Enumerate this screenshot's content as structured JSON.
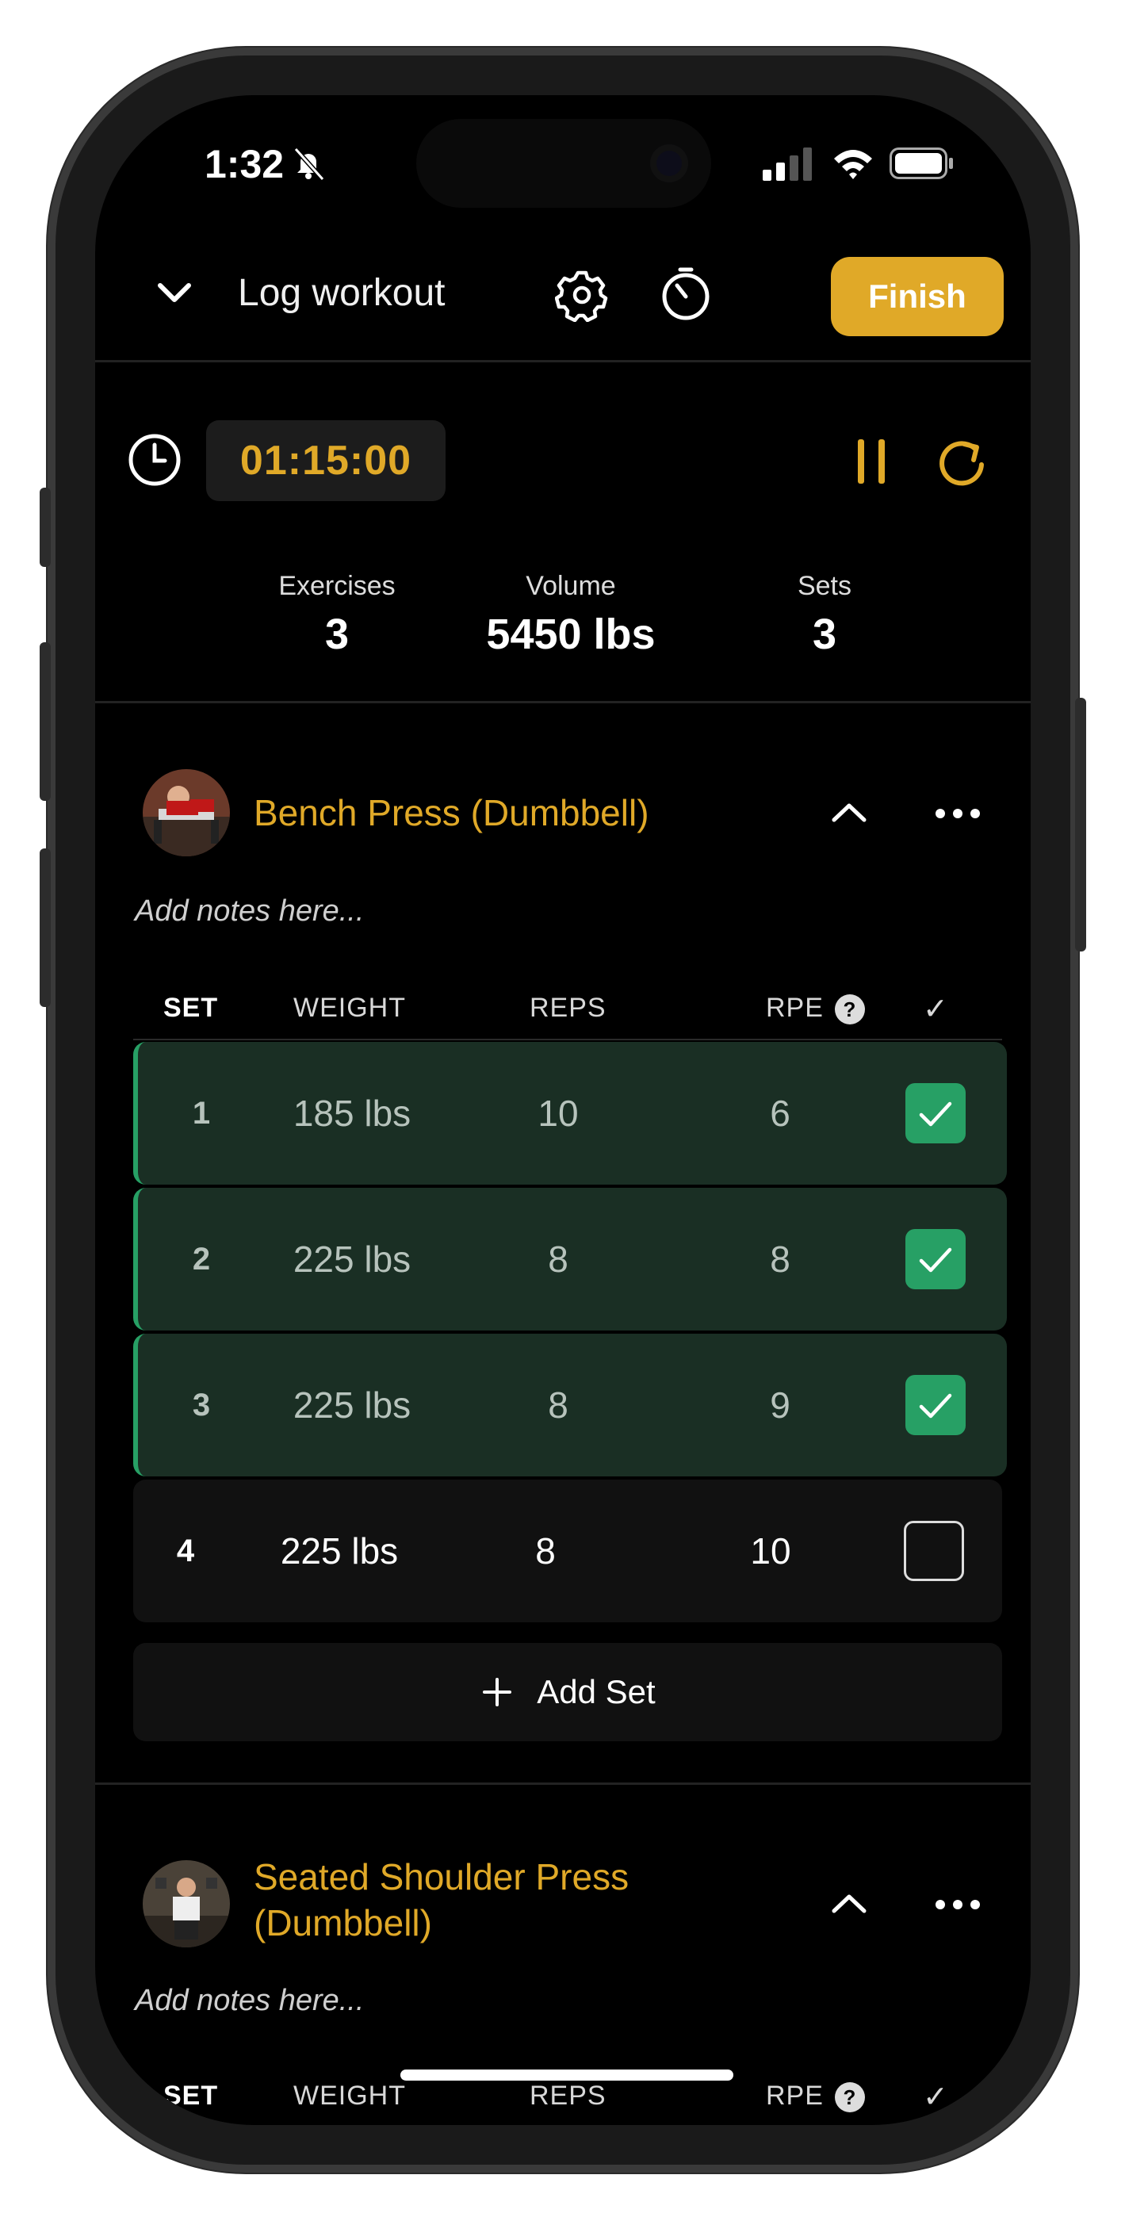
{
  "status_bar": {
    "time": "1:32"
  },
  "header": {
    "title": "Log workout",
    "finish_label": "Finish"
  },
  "timer": {
    "value": "01:15:00"
  },
  "stats": {
    "exercises_label": "Exercises",
    "exercises_value": "3",
    "volume_label": "Volume",
    "volume_value": "5450 lbs",
    "sets_label": "Sets",
    "sets_value": "3"
  },
  "exercises": [
    {
      "name": "Bench Press (Dumbbell)",
      "notes_placeholder": "Add notes here...",
      "columns": {
        "set": "SET",
        "weight": "WEIGHT",
        "reps": "REPS",
        "rpe": "RPE",
        "rpe_help": "?",
        "check": "✓"
      },
      "sets": [
        {
          "set": "1",
          "weight": "185 lbs",
          "reps": "10",
          "rpe": "6",
          "completed": true
        },
        {
          "set": "2",
          "weight": "225 lbs",
          "reps": "8",
          "rpe": "8",
          "completed": true
        },
        {
          "set": "3",
          "weight": "225 lbs",
          "reps": "8",
          "rpe": "9",
          "completed": true
        },
        {
          "set": "4",
          "weight": "225 lbs",
          "reps": "8",
          "rpe": "10",
          "completed": false
        }
      ],
      "add_set_label": "Add Set"
    },
    {
      "name_line1": "Seated Shoulder Press",
      "name_line2": "(Dumbbell)",
      "notes_placeholder": "Add notes here...",
      "columns": {
        "set": "SET",
        "weight": "WEIGHT",
        "reps": "REPS",
        "rpe": "RPE",
        "rpe_help": "?",
        "check": "✓"
      }
    }
  ],
  "colors": {
    "accent": "#e0a928",
    "done_row": "#1a2f24",
    "done_check": "#27a065",
    "background": "#000000"
  }
}
